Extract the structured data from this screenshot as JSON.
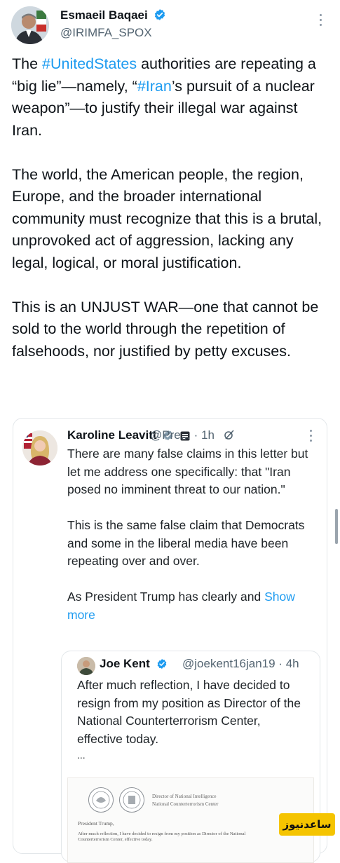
{
  "post": {
    "author": {
      "name": "Esmaeil Baqaei",
      "handle": "@IRIMFA_SPOX"
    },
    "paragraphs": [
      [
        {
          "t": "The ",
          "tag": false
        },
        {
          "t": "#UnitedStates",
          "tag": true
        },
        {
          "t": " authorities are repeating a “big lie”—namely, “",
          "tag": false
        },
        {
          "t": "#Iran",
          "tag": true
        },
        {
          "t": "’s pursuit of a nuclear weapon”—to justify their illegal war against Iran.",
          "tag": false
        }
      ],
      [
        {
          "t": "The world, the American people, the region, Europe, and the broader international community must recognize that this is a brutal, unprovoked act of aggression, lacking any legal, logical, or moral justification.",
          "tag": false
        }
      ],
      [
        {
          "t": "This is an UNJUST WAR—one that cannot be sold to the world through the repetition of falsehoods, nor justified by petty excuses.",
          "tag": false
        }
      ]
    ]
  },
  "quote": {
    "author": {
      "name": "Karoline Leavitt",
      "meta": "@Pre... · 1h"
    },
    "p1": "There are many false claims in this letter but let me address one specifically: that \"Iran posed no imminent threat to our nation.\"",
    "p2": "This is the same false claim that Democrats and some in the liberal media have been repeating over and over.",
    "p3_text": "As President Trump has clearly and ",
    "show_more": "Show more",
    "inner": {
      "author": {
        "name": "Joe Kent",
        "meta": "@joekent16jan19 · 4h"
      },
      "text": "After much reflection, I have decided to resign from my position as Director of the National Counterterrorism Center, effective today.",
      "ellipsis": "...",
      "letter": {
        "header_1": "Director of National Intelligence",
        "header_2": "National Counterterrorism Center",
        "salutation": "President Trump,",
        "body_1": "After much reflection, I have decided to resign from my position as Director of the National",
        "body_2": "Counterterrorism Center, effective today."
      }
    }
  },
  "watermark": "ساعدنیوز",
  "colors": {
    "link": "#1d9bf0",
    "verified": "#1d9bf0",
    "watermark_bg": "#f5c400"
  }
}
